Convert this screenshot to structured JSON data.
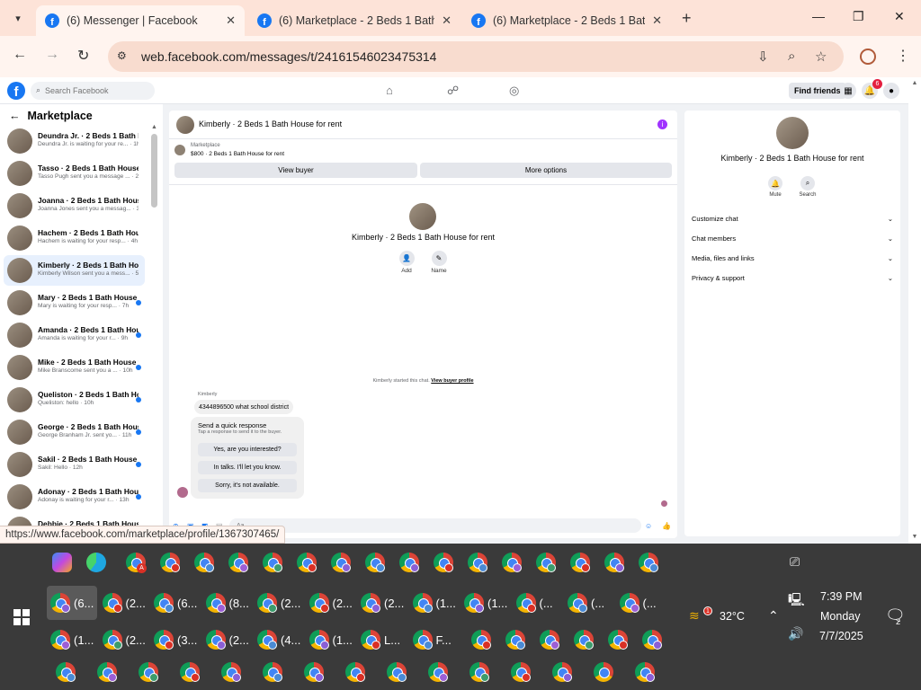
{
  "browser": {
    "tabs": [
      {
        "title": "(6) Messenger | Facebook",
        "active": true
      },
      {
        "title": "(6) Marketplace - 2 Beds 1 Bath",
        "active": false
      },
      {
        "title": "(6) Marketplace - 2 Beds 1 Bath",
        "active": false
      }
    ],
    "url": "web.facebook.com/messages/t/24161546023475314",
    "status_url": "https://www.facebook.com/marketplace/profile/1367307465/"
  },
  "fb": {
    "search_placeholder": "Search Facebook",
    "find_friends": "Find friends",
    "notification_count": "6"
  },
  "left": {
    "header": "Marketplace",
    "conversations": [
      {
        "title": "Deundra Jr. · 2 Beds 1 Bath Ho...",
        "preview": "Deundra Jr. is waiting for your re... · 1h",
        "unread": false,
        "selected": false
      },
      {
        "title": "Tasso · 2 Beds 1 Bath House fo...",
        "preview": "Tasso Pugh sent you a message ... · 2h",
        "unread": false,
        "selected": false
      },
      {
        "title": "Joanna · 2 Beds 1 Bath House ...",
        "preview": "Joanna Jones sent you a messag... · 3h",
        "unread": false,
        "selected": false
      },
      {
        "title": "Hachem · 2 Beds 1 Bath House...",
        "preview": "Hachem is waiting for your resp... · 4h",
        "unread": false,
        "selected": false
      },
      {
        "title": "Kimberly · 2 Beds 1 Bath Hous...",
        "preview": "Kimberly Wilson sent you a mess... · 5h",
        "unread": false,
        "selected": true
      },
      {
        "title": "Mary · 2 Beds 1 Bath House ...",
        "preview": "Mary is waiting for your resp... · 7h",
        "unread": true,
        "selected": false
      },
      {
        "title": "Amanda · 2 Beds 1 Bath Hou...",
        "preview": "Amanda is waiting for your r... · 9h",
        "unread": true,
        "selected": false
      },
      {
        "title": "Mike · 2 Beds 1 Bath House f...",
        "preview": "Mike Branscome sent you a ... · 10h",
        "unread": true,
        "selected": false
      },
      {
        "title": "Queliston · 2 Beds 1 Bath Ho...",
        "preview": "Queliston: hello · 10h",
        "unread": true,
        "selected": false
      },
      {
        "title": "George · 2 Beds 1 Bath Hous...",
        "preview": "George Branham Jr. sent yo... · 11h",
        "unread": true,
        "selected": false
      },
      {
        "title": "Sakil · 2 Beds 1 Bath House f...",
        "preview": "Sakil: Hello · 12h",
        "unread": true,
        "selected": false
      },
      {
        "title": "Adonay · 2 Beds 1 Bath Hous...",
        "preview": "Adonay is waiting for your r... · 13h",
        "unread": true,
        "selected": false
      },
      {
        "title": "Debbie · 2 Beds 1 Bath Hous...",
        "preview": "",
        "unread": false,
        "selected": false
      }
    ]
  },
  "chat": {
    "title": "Kimberly · 2 Beds 1 Bath House for rent",
    "marketplace_label": "Marketplace",
    "listing": "$800 · 2 Beds 1 Bath House for rent",
    "view_buyer": "View buyer",
    "more_options": "More options",
    "center_name": "Kimberly · 2 Beds 1 Bath House for rent",
    "add_label": "Add",
    "name_label": "Name",
    "started_text": "Kimberly started this chat.",
    "view_buyer_profile": "View buyer profile",
    "sender": "Kimberly",
    "message": "4344896500 what school district",
    "quick_title": "Send a quick response",
    "quick_sub": "Tap a response to send it to the buyer.",
    "quick_replies": [
      "Yes, are you interested?",
      "In talks. I'll let you know.",
      "Sorry, it's not available."
    ],
    "composer_placeholder": "Aa"
  },
  "right": {
    "name": "Kimberly · 2 Beds 1 Bath House for rent",
    "mute": "Mute",
    "search": "Search",
    "items": [
      "Customize chat",
      "Chat members",
      "Media, files and links",
      "Privacy & support"
    ]
  },
  "taskbar": {
    "groups_row2": [
      "(6...",
      "(2...",
      "(6...",
      "(8...",
      "(2...",
      "(2...",
      "(2...",
      "(1...",
      "(1...",
      "(...",
      "(...",
      "(..."
    ],
    "groups_row3": [
      "(1...",
      "(2...",
      "(3...",
      "(2...",
      "(4...",
      "(1...",
      "L...",
      "F..."
    ],
    "weather": "32°C",
    "weather_badge": "1",
    "time": "7:39 PM",
    "day": "Monday",
    "date": "7/7/2025",
    "notification_count": "2",
    "copilot_badge": "A"
  }
}
